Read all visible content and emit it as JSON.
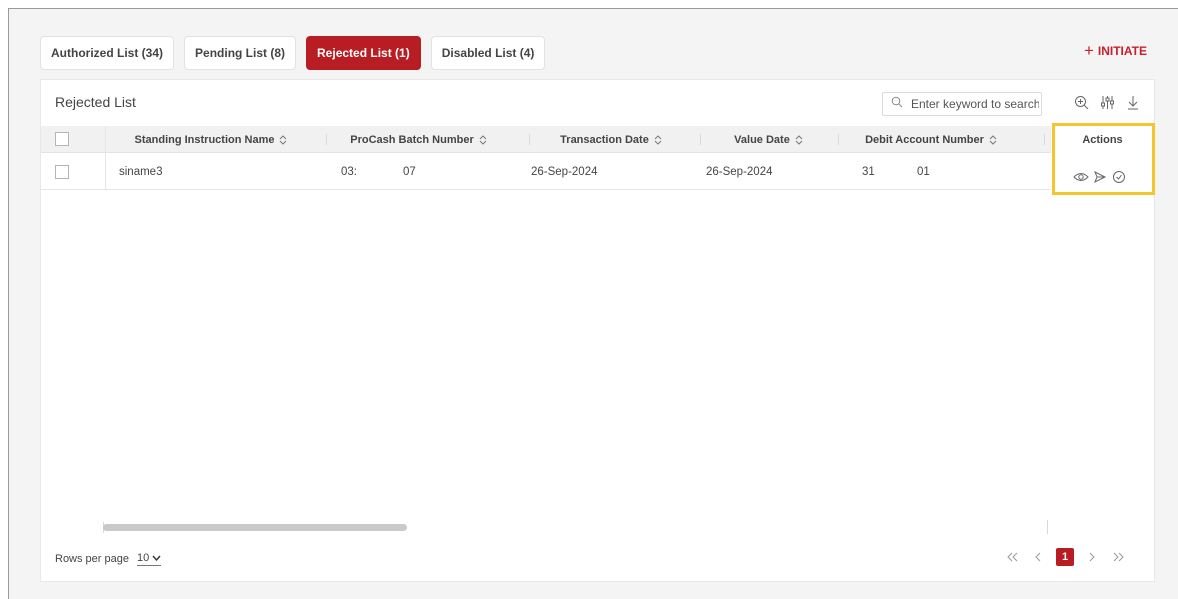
{
  "tabs": [
    {
      "label": "Authorized List (34)",
      "active": false
    },
    {
      "label": "Pending List (8)",
      "active": false
    },
    {
      "label": "Rejected List (1)",
      "active": true
    },
    {
      "label": "Disabled List (4)",
      "active": false
    }
  ],
  "initiate": {
    "icon": "plus-icon",
    "label": "INITIATE"
  },
  "list": {
    "title": "Rejected List",
    "search_placeholder": "Enter keyword to search",
    "tool_icons": [
      "zoom-in-icon",
      "filter-sliders-icon",
      "download-icon"
    ]
  },
  "table": {
    "columns": [
      {
        "label": "Standing Instruction Name",
        "sortable": true
      },
      {
        "label": "ProCash Batch Number",
        "sortable": true
      },
      {
        "label": "Transaction Date",
        "sortable": true
      },
      {
        "label": "Value Date",
        "sortable": true
      },
      {
        "label": "Debit Account Number",
        "sortable": true
      },
      {
        "label": "Actions",
        "sortable": false
      }
    ],
    "rows": [
      {
        "si_name": "siname3",
        "batch_part1": "03:",
        "batch_part2": "07",
        "txn_date": "26-Sep-2024",
        "value_date": "26-Sep-2024",
        "debit_part1": "31",
        "debit_part2": "01",
        "actions": [
          "eye-icon",
          "send-icon",
          "check-circle-icon"
        ]
      }
    ]
  },
  "footer": {
    "rows_per_page_label": "Rows per page",
    "rows_per_page_value": "10",
    "current_page": "1"
  },
  "colors": {
    "accent": "#b81d24",
    "initiate": "#c8202c",
    "highlight": "#f6c42d"
  }
}
